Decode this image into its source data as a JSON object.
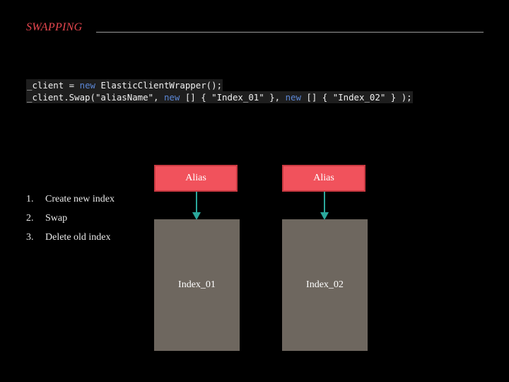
{
  "slide": {
    "title": "SWAPPING"
  },
  "code": {
    "line1": {
      "part1": "_client = ",
      "kw1": "new",
      "part2": " ElasticClientWrapper();"
    },
    "line2": {
      "part1": "_client.Swap(\"aliasName\", ",
      "kw1": "new",
      "part2": " [] { \"Index_01\" }, ",
      "kw2": "new",
      "part3": " [] { \"Index_02\" } );"
    }
  },
  "steps": [
    {
      "number": "1.",
      "text": "Create new index"
    },
    {
      "number": "2.",
      "text": "Swap"
    },
    {
      "number": "3.",
      "text": "Delete old index"
    }
  ],
  "diagram": {
    "alias_left": "Alias",
    "alias_right": "Alias",
    "index_left": "Index_01",
    "index_right": "Index_02"
  },
  "colors": {
    "title": "#e8474f",
    "alias_fill": "#f1525c",
    "index_fill": "#6e675f",
    "arrow": "#2ba89c",
    "keyword": "#5b86d4"
  },
  "icons": {
    "arrow_left": "arrow-down-icon",
    "arrow_right": "arrow-down-icon"
  }
}
